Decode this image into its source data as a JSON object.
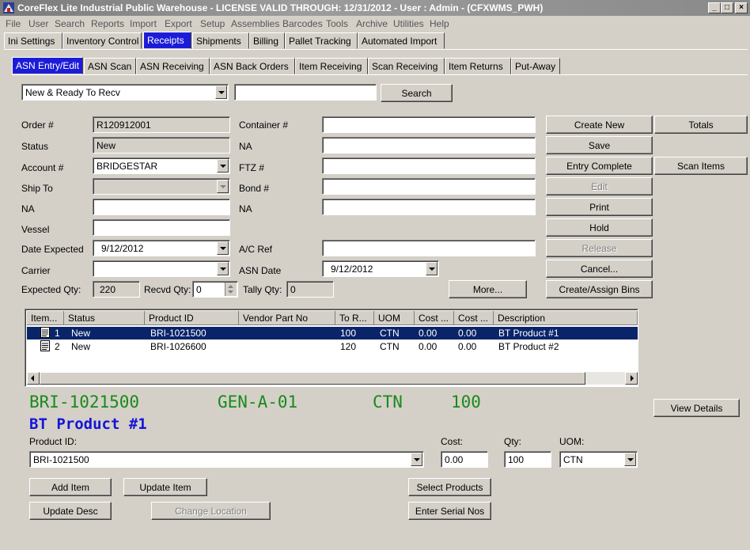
{
  "window": {
    "title": "CoreFlex Lite Industrial Public Warehouse - LICENSE VALID THROUGH: 12/31/2012 - User : Admin - (CFXWMS_PWH)",
    "minimize": "_",
    "maximize": "□",
    "close": "×"
  },
  "menu": [
    "File",
    "User",
    "Search",
    "Reports",
    "Import",
    "Export",
    "Setup",
    "Assemblies",
    "Barcodes",
    "Tools",
    "Archive",
    "Utilities",
    "Help"
  ],
  "main_tabs": [
    "Ini Settings",
    "Inventory Control",
    "Receipts",
    "Shipments",
    "Billing",
    "Pallet Tracking",
    "Automated Import"
  ],
  "sub_tabs": [
    "ASN Entry/Edit",
    "ASN Scan",
    "ASN Receiving",
    "ASN Back Orders",
    "Item Receiving",
    "Scan Receiving",
    "Item Returns",
    "Put-Away"
  ],
  "filter": {
    "value": "New & Ready To Recv",
    "search_text": "",
    "search_button": "Search"
  },
  "form": {
    "order_label": "Order #",
    "order_value": "R120912001",
    "status_label": "Status",
    "status_value": "New",
    "account_label": "Account #",
    "account_value": "BRIDGESTAR",
    "shipto_label": "Ship To",
    "shipto_value": "",
    "na1_label": "NA",
    "na1_value": "",
    "vessel_label": "Vessel",
    "vessel_value": "",
    "date_expected_label": "Date Expected",
    "date_expected_value": "9/12/2012",
    "carrier_label": "Carrier",
    "carrier_value": "",
    "container_label": "Container #",
    "container_value": "",
    "na2_label": "NA",
    "na2_value": "",
    "ftz_label": "FTZ #",
    "ftz_value": "",
    "bond_label": "Bond #",
    "bond_value": "",
    "na3_label": "NA",
    "na3_value": "",
    "acref_label": "A/C Ref",
    "acref_value": "",
    "asn_date_label": "ASN Date",
    "asn_date_value": "9/12/2012",
    "expected_qty_label": "Expected Qty:",
    "expected_qty_value": "220",
    "recvd_qty_label": "Recvd Qty:",
    "recvd_qty_value": "0",
    "tally_qty_label": "Tally Qty:",
    "tally_qty_value": "0",
    "more_button": "More..."
  },
  "actions": {
    "create_new": "Create New",
    "totals": "Totals",
    "save": "Save",
    "entry_complete": "Entry Complete",
    "scan_items": "Scan Items",
    "edit": "Edit",
    "print": "Print",
    "hold": "Hold",
    "release": "Release",
    "cancel": "Cancel...",
    "create_assign_bins": "Create/Assign Bins"
  },
  "grid": {
    "columns": [
      "Item...",
      "Status",
      "Product ID",
      "Vendor Part No",
      "To R...",
      "UOM",
      "Cost ...",
      "Cost ...",
      "Description"
    ],
    "rows": [
      {
        "item": "1",
        "status": "New",
        "product_id": "BRI-1021500",
        "vendor_part": "",
        "to_recv": "100",
        "uom": "CTN",
        "cost1": "0.00",
        "cost2": "0.00",
        "description": "BT Product #1"
      },
      {
        "item": "2",
        "status": "New",
        "product_id": "BRI-1026600",
        "vendor_part": "",
        "to_recv": "120",
        "uom": "CTN",
        "cost1": "0.00",
        "cost2": "0.00",
        "description": "BT Product #2"
      }
    ]
  },
  "detail": {
    "product_code": "BRI-1021500",
    "location": "GEN-A-01",
    "uom": "CTN",
    "qty": "100",
    "description": "BT Product #1",
    "view_details": "View Details",
    "product_id_label": "Product ID:",
    "product_id_value": "BRI-1021500",
    "cost_label": "Cost:",
    "cost_value": "0.00",
    "qty_label": "Qty:",
    "qty_value": "100",
    "uom_label": "UOM:",
    "uom_value": "CTN",
    "add_item": "Add Item",
    "update_item": "Update Item",
    "select_products": "Select Products",
    "update_desc": "Update Desc",
    "change_location": "Change Location",
    "enter_serial_nos": "Enter Serial Nos"
  }
}
